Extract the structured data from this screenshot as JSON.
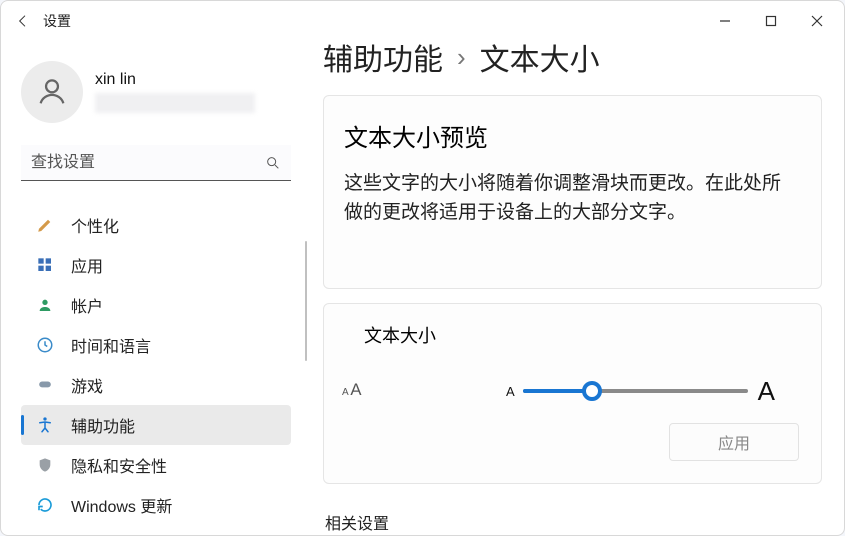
{
  "app_title": "设置",
  "user": {
    "name": "xin lin"
  },
  "search": {
    "placeholder": "查找设置"
  },
  "sidebar": {
    "items": [
      {
        "label": "个性化",
        "icon": "brush-icon"
      },
      {
        "label": "应用",
        "icon": "apps-icon"
      },
      {
        "label": "帐户",
        "icon": "person-icon"
      },
      {
        "label": "时间和语言",
        "icon": "clock-icon"
      },
      {
        "label": "游戏",
        "icon": "gamepad-icon"
      },
      {
        "label": "辅助功能",
        "icon": "accessibility-icon",
        "active": true
      },
      {
        "label": "隐私和安全性",
        "icon": "shield-icon"
      },
      {
        "label": "Windows 更新",
        "icon": "update-icon"
      }
    ]
  },
  "breadcrumb": {
    "parent": "辅助功能",
    "current": "文本大小"
  },
  "preview": {
    "title": "文本大小预览",
    "body": "这些文字的大小将随着你调整滑块而更改。在此处所做的更改将适用于设备上的大部分文字。"
  },
  "text_size": {
    "label": "文本大小",
    "min_glyph": "A",
    "max_glyph": "A",
    "slider_percent": 31,
    "apply_label": "应用"
  },
  "related_heading": "相关设置"
}
